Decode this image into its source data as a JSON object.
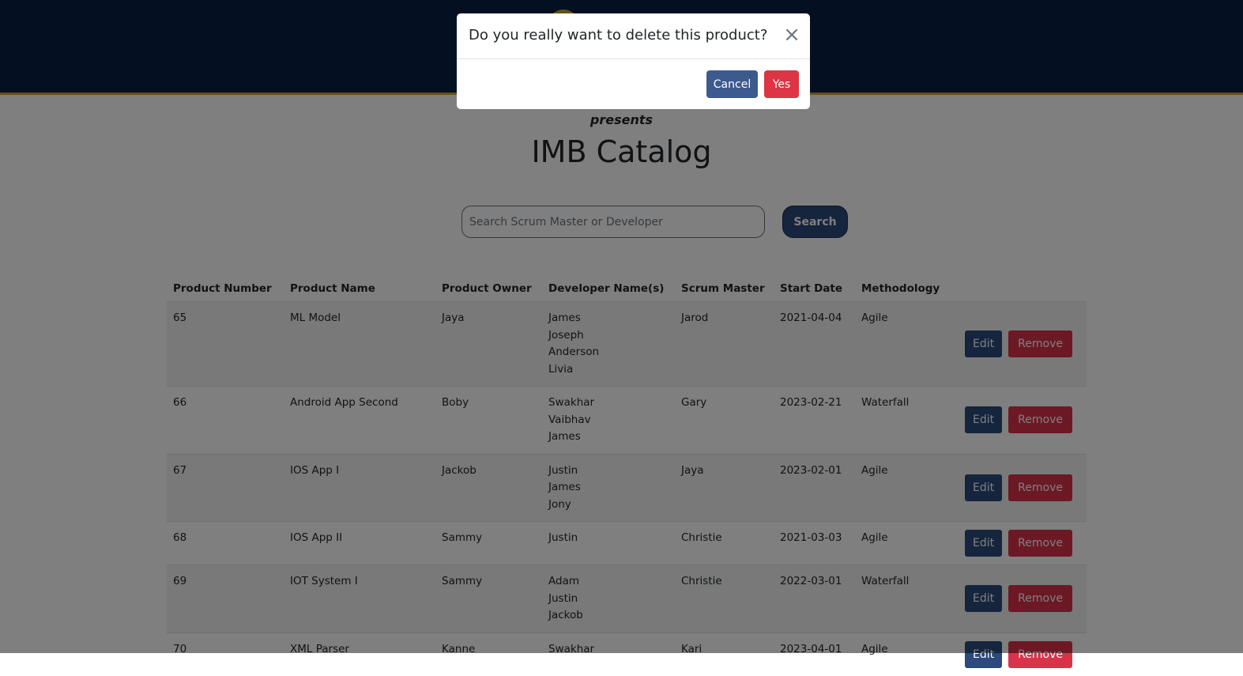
{
  "header": {
    "logo": "logo"
  },
  "presents": "presents",
  "title": "IMB Catalog",
  "search": {
    "placeholder": "Search Scrum Master or Developer",
    "button": "Search"
  },
  "table": {
    "columns": [
      "Product Number",
      "Product Name",
      "Product Owner",
      "Developer Name(s)",
      "Scrum Master",
      "Start Date",
      "Methodology"
    ],
    "rows": [
      {
        "number": "65",
        "name": "ML Model",
        "owner": "Jaya",
        "developers": [
          "James",
          "Joseph",
          "Anderson",
          "Livia"
        ],
        "scrum": "Jarod",
        "start": "2021-04-04",
        "method": "Agile"
      },
      {
        "number": "66",
        "name": "Android App Second",
        "owner": "Boby",
        "developers": [
          "Swakhar",
          "Vaibhav",
          "James"
        ],
        "scrum": "Gary",
        "start": "2023-02-21",
        "method": "Waterfall"
      },
      {
        "number": "67",
        "name": "IOS App I",
        "owner": "Jackob",
        "developers": [
          "Justin",
          "James",
          "Jony"
        ],
        "scrum": "Jaya",
        "start": "2023-02-01",
        "method": "Agile"
      },
      {
        "number": "68",
        "name": "IOS App II",
        "owner": "Sammy",
        "developers": [
          "Justin"
        ],
        "scrum": "Christie",
        "start": "2021-03-03",
        "method": "Agile"
      },
      {
        "number": "69",
        "name": "IOT System I",
        "owner": "Sammy",
        "developers": [
          "Adam",
          "Justin",
          "Jackob"
        ],
        "scrum": "Christie",
        "start": "2022-03-01",
        "method": "Waterfall"
      },
      {
        "number": "70",
        "name": "XML Parser",
        "owner": "Kanne",
        "developers": [
          "Swakhar"
        ],
        "scrum": "Kari",
        "start": "2023-04-01",
        "method": "Agile"
      }
    ],
    "edit_label": "Edit",
    "remove_label": "Remove"
  },
  "modal": {
    "title": "Do you really want to delete this product?",
    "close_symbol": "×",
    "cancel": "Cancel",
    "confirm": "Yes"
  },
  "colors": {
    "header_bg": "#0a1f44",
    "accent_gold": "#c9a227",
    "primary": "#2c4a7d",
    "danger": "#dc3545"
  }
}
